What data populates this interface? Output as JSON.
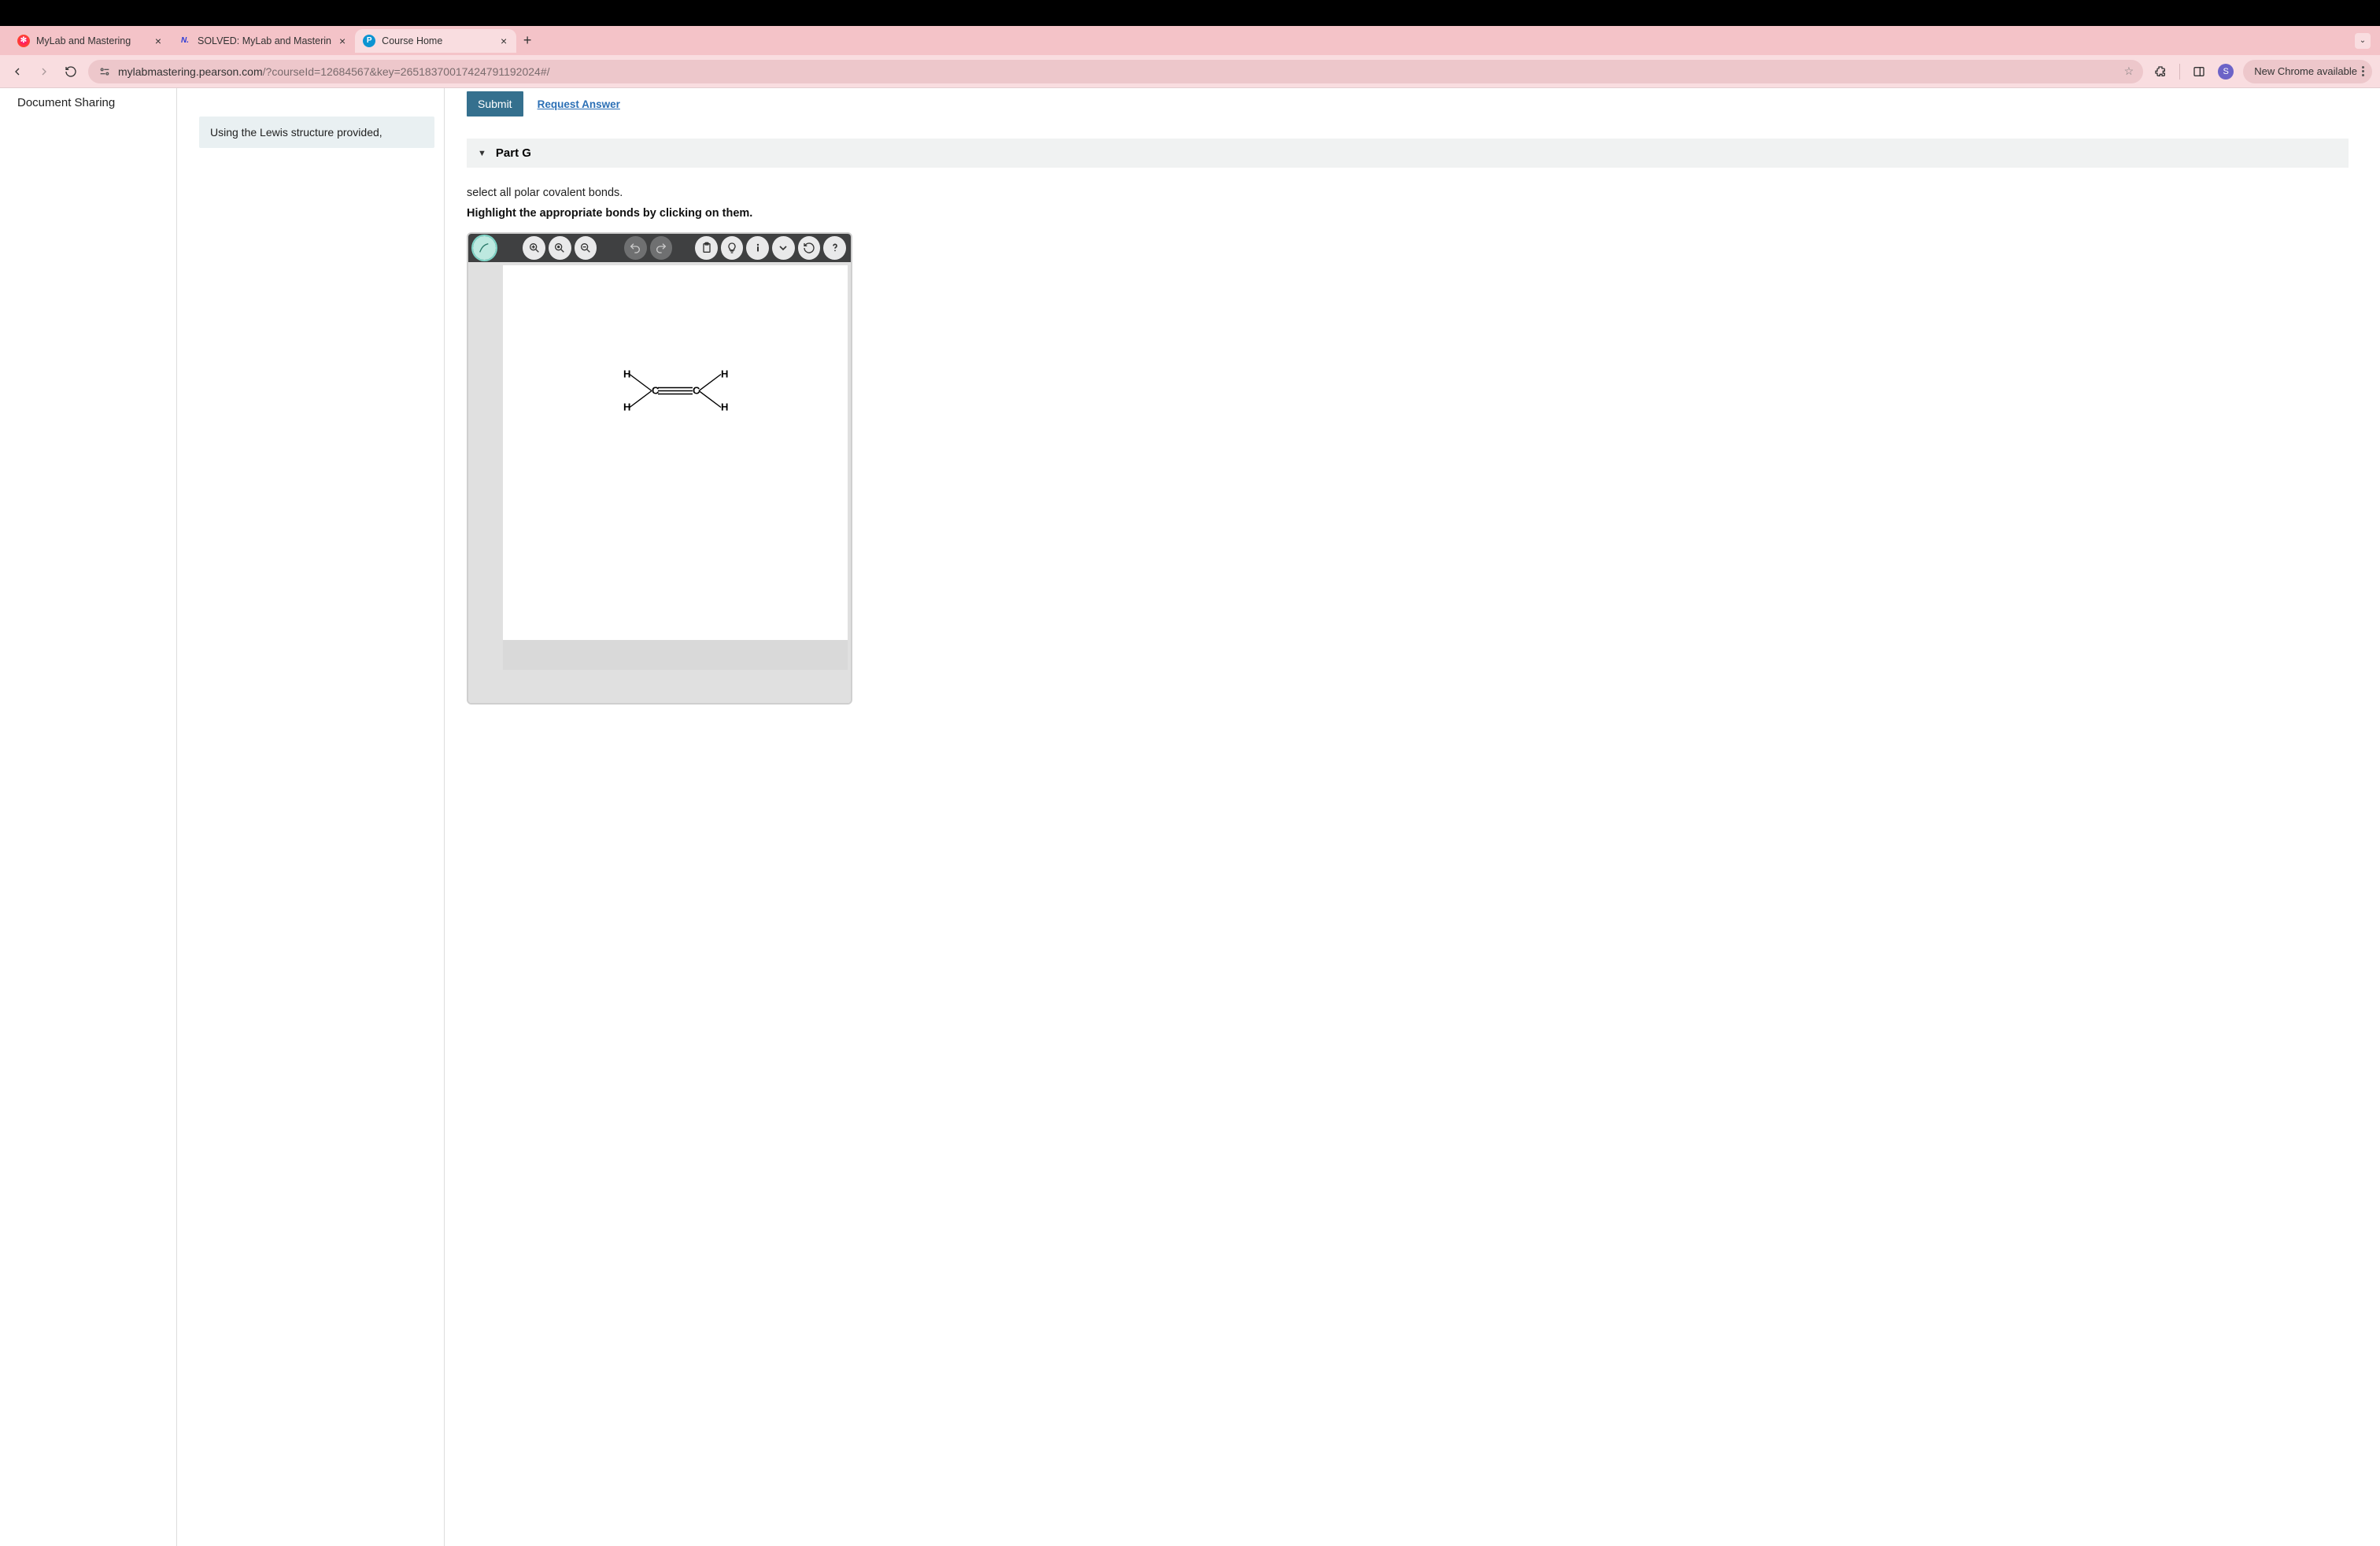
{
  "browser": {
    "tabs": [
      {
        "title": "MyLab and Mastering"
      },
      {
        "title": "SOLVED: MyLab and Masterin"
      },
      {
        "title": "Course Home"
      }
    ],
    "url_primary": "mylabmastering.pearson.com",
    "url_secondary": "/?courseId=12684567&key=26518370017424791192024#/",
    "update_label": "New Chrome available",
    "profile_initial": "S"
  },
  "sidebar": {
    "item": "Document Sharing"
  },
  "instruction": "Using the Lewis structure provided,",
  "actions": {
    "submit": "Submit",
    "request": "Request Answer"
  },
  "part": {
    "label": "Part G"
  },
  "prompt": {
    "line1": "select all polar covalent bonds.",
    "line2": "Highlight the appropriate bonds by clicking on them."
  },
  "molecule": {
    "atoms": {
      "h_tl": "H",
      "h_bl": "H",
      "c_l": "C",
      "c_r": "C",
      "h_tr": "H",
      "h_br": "H"
    }
  },
  "favicons": {
    "pearson": "P",
    "numerade": "N."
  }
}
